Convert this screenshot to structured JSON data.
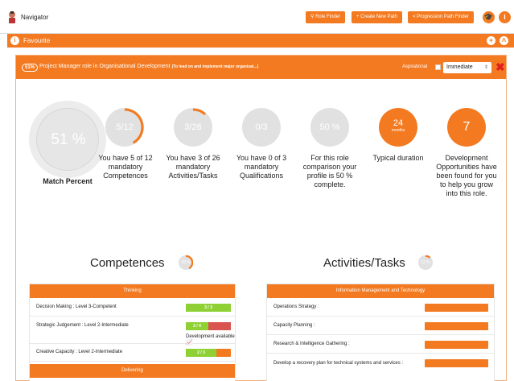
{
  "navbar": {
    "title": "Navigator",
    "buttons": {
      "role_finder": "Role Finder",
      "create_path": "Create New Path",
      "progression_finder": "Progression Path Finder"
    }
  },
  "favourite": {
    "label": "Favourite"
  },
  "role": {
    "match_pill": "51%",
    "title": "Project Manager role in Organisational Development",
    "subtitle": "(To lead on and implement major organisat...)",
    "aspirational_label": "Aspirational",
    "timeframe": "Immediate"
  },
  "summary": {
    "match_value": "51 %",
    "match_label": "Match Percent",
    "stats": [
      {
        "value": "5/12",
        "progress": 0.42,
        "desc": "You have 5 of 12 mandatory Competences"
      },
      {
        "value": "3/26",
        "progress": 0.12,
        "desc": "You have 3 of 26 mandatory Activities/Tasks"
      },
      {
        "value": "0/3",
        "progress": 0.0,
        "desc": "You have 0 of 3 mandatory Qualifications"
      },
      {
        "value": "50 %",
        "progress": 0.5,
        "desc": "For this role comparison your profile is 50 % complete."
      },
      {
        "value": "24",
        "unit": "months",
        "desc": "Typical duration"
      },
      {
        "value": "7",
        "desc": "Development Opportunities have been found for you to help you grow into this role."
      }
    ]
  },
  "competences": {
    "title": "Competences",
    "badge": "42 %",
    "badge_progress": 0.42,
    "group_1": "Thinking",
    "rows": [
      {
        "label": "Decision Making : Level 3-Competent",
        "bar": "3 / 3",
        "fill": 1.0
      },
      {
        "label": "Strategic Judgement : Level 2-Intermediate",
        "bar": "2 / 4",
        "fill": 0.5,
        "note": "Development available"
      },
      {
        "label": "Creative Capacity : Level 2-Intermediate",
        "bar": "2 / 3",
        "fill": 0.67
      }
    ],
    "group_2": "Delivering"
  },
  "activities": {
    "title": "Activities/Tasks",
    "badge": "12 %",
    "badge_progress": 0.12,
    "group_1": "Information Management and Technology",
    "rows": [
      {
        "label": "Operations Strategy :"
      },
      {
        "label": "Capacity Planning :"
      },
      {
        "label": "Research & Intelligence Gathering :"
      },
      {
        "label": "Develop a recovery plan for technical systems and services :"
      }
    ]
  },
  "colors": {
    "accent": "#f37a20",
    "green": "#8fd134",
    "red": "#d9534f",
    "gray": "#e1e1e1"
  }
}
